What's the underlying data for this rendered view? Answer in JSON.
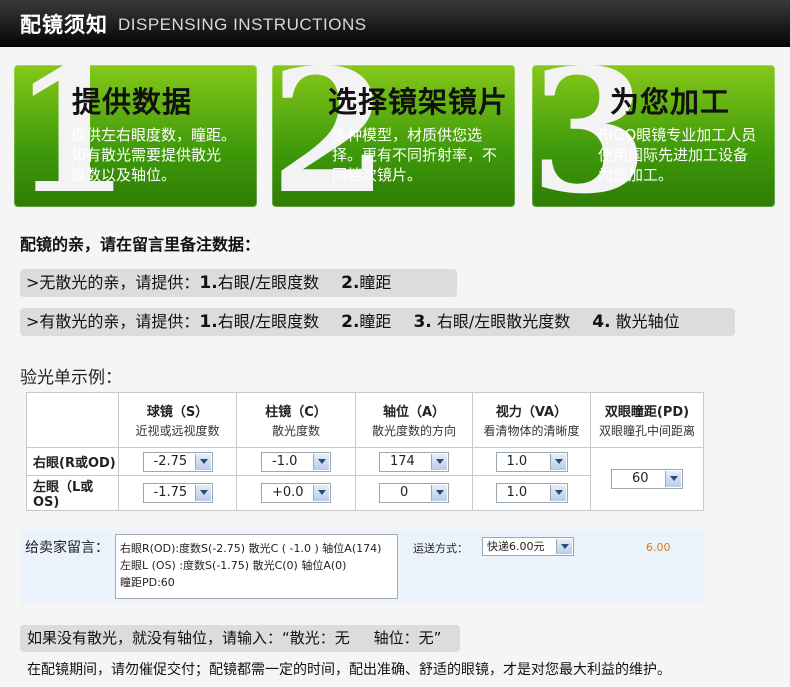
{
  "header": {
    "title_cn": "配镜须知",
    "title_en": "DISPENSING INSTRUCTIONS"
  },
  "steps": [
    {
      "num": "1",
      "title": "提供数据",
      "desc": "提供左右眼度数，瞳距。\n如有散光需要提供散光\n度数以及轴位。"
    },
    {
      "num": "2",
      "title": "选择镜架镜片",
      "desc": "多种模型，材质供您选\n择。更有不同折射率，不\n同档次镜片。"
    },
    {
      "num": "3",
      "title": "为您加工",
      "desc": "RIGO眼镜专业加工人员\n使用国际先进加工设备\n为您加工。"
    }
  ],
  "instructions": {
    "title": "配镜的亲，请在留言里备注数据：",
    "no_astig": {
      "prefix": ">无散光的亲，请提供：",
      "n1": "1.",
      "t1": "右眼/左眼度数",
      "n2": "2.",
      "t2": "瞳距"
    },
    "astig": {
      "prefix": ">有散光的亲，请提供：",
      "n1": "1.",
      "t1": "右眼/左眼度数",
      "n2": "2.",
      "t2": "瞳距",
      "n3": "3.",
      "t3": "右眼/左眼散光度数",
      "n4": "4.",
      "t4": "散光轴位"
    }
  },
  "example_title": "验光单示例：",
  "table": {
    "headers": [
      {
        "title": "球镜（S）",
        "sub": "近视或远视度数"
      },
      {
        "title": "柱镜（C）",
        "sub": "散光度数"
      },
      {
        "title": "轴位（A）",
        "sub": "散光度数的方向"
      },
      {
        "title": "视力（VA）",
        "sub": "看清物体的清晰度"
      },
      {
        "title": "双眼瞳距(PD)",
        "sub": "双眼瞳孔中间距离"
      }
    ],
    "right": {
      "label": "右眼(R或OD)",
      "s": "-2.75",
      "c": "-1.0",
      "a": "174",
      "va": "1.0"
    },
    "left": {
      "label": "左眼（L或OS)",
      "s": "-1.75",
      "c": "+0.0",
      "a": "0",
      "va": "1.0"
    },
    "pd": "60"
  },
  "message": {
    "label": "给卖家留言：",
    "text": "右眼R(OD):度数S(-2.75) 散光C ( -1.0 ) 轴位A(174)\n左眼L (OS) :度数S(-1.75) 散光C(0) 轴位A(0)\n瞳距PD:60",
    "ship_label": "运送方式：",
    "ship_value": "快递6.00元",
    "price": "6.00"
  },
  "note": "如果没有散光，就没有轴位，请输入：“散光：无     轴位：无”",
  "footer": "在配镜期间，请勿催促交付；配镜都需一定的时间，配出准确、舒适的眼镜，才是对您最大利益的维护。"
}
